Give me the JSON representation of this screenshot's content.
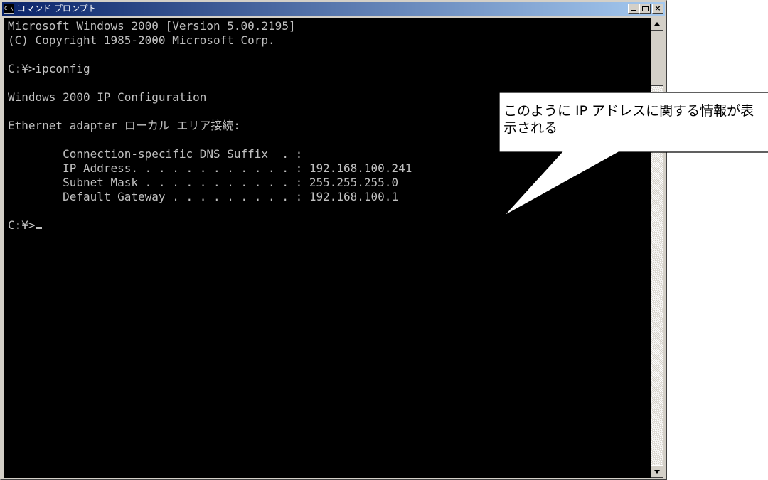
{
  "window": {
    "title": "コマンド プロンプト",
    "sys_icon_glyph": "C:\\",
    "minimize_glyph": "_",
    "maximize_glyph": "□",
    "close_glyph": "×"
  },
  "console": {
    "lines": [
      "Microsoft Windows 2000 [Version 5.00.2195]",
      "(C) Copyright 1985-2000 Microsoft Corp.",
      "",
      "C:¥>ipconfig",
      "",
      "Windows 2000 IP Configuration",
      "",
      "Ethernet adapter ローカル エリア接続:",
      "",
      "        Connection-specific DNS Suffix  . :",
      "        IP Address. . . . . . . . . . . . : 192.168.100.241",
      "        Subnet Mask . . . . . . . . . . . : 255.255.255.0",
      "        Default Gateway . . . . . . . . . : 192.168.100.1",
      "",
      "C:¥>"
    ],
    "colors": {
      "background": "#000000",
      "text": "#c0c0c0"
    }
  },
  "callout": {
    "text": "このように IP アドレスに関する情報が表示される"
  },
  "colors": {
    "titlebar_start": "#0a246a",
    "titlebar_end": "#a6caf0",
    "chrome": "#d4d0c8"
  }
}
